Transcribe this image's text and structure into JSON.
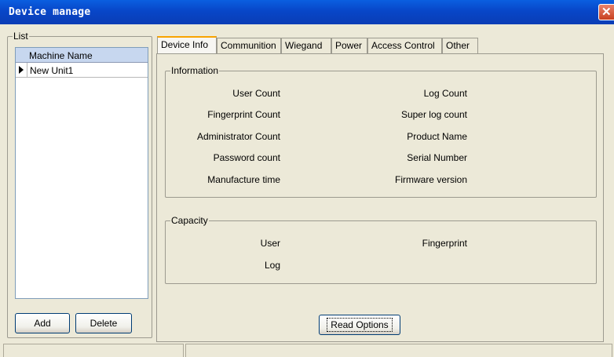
{
  "window": {
    "title": "Device manage"
  },
  "list": {
    "legend": "List",
    "column_header": "Machine Name",
    "rows": [
      "New Unit1"
    ],
    "add_label": "Add",
    "delete_label": "Delete"
  },
  "tabs": [
    {
      "label": "Device Info",
      "active": true
    },
    {
      "label": "Communition"
    },
    {
      "label": "Wiegand"
    },
    {
      "label": "Power"
    },
    {
      "label": "Access Control"
    },
    {
      "label": "Other"
    }
  ],
  "information": {
    "legend": "Information",
    "left_labels": [
      "User Count",
      "Fingerprint Count",
      "Administrator Count",
      "Password count",
      "Manufacture time"
    ],
    "right_labels": [
      "Log Count",
      "Super log count",
      "Product Name",
      "Serial Number",
      "Firmware version"
    ]
  },
  "capacity": {
    "legend": "Capacity",
    "left_labels": [
      "User",
      "Log"
    ],
    "right_labels": [
      "Fingerprint"
    ]
  },
  "read_options_label": "Read Options",
  "colors": {
    "titlebar": "#0846c8",
    "close": "#c8401f",
    "header_bg": "#c7d7ef",
    "tab_highlight": "#f8a300"
  }
}
